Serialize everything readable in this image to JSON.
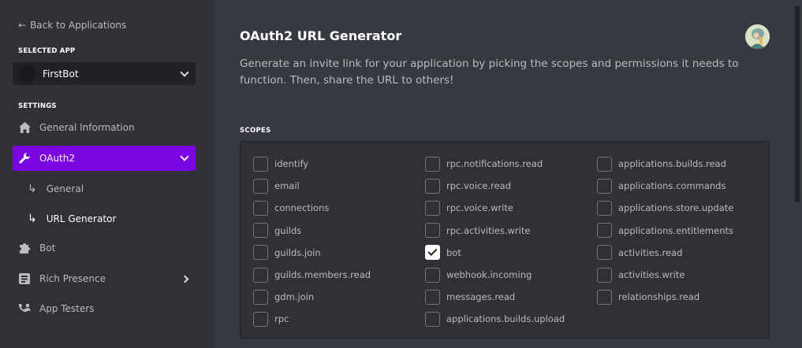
{
  "sidebar": {
    "back_label": "Back to Applications",
    "selected_app_label": "SELECTED APP",
    "app_name": "FirstBot",
    "settings_label": "SETTINGS",
    "items": [
      {
        "label": "General Information"
      },
      {
        "label": "OAuth2"
      },
      {
        "label": "General"
      },
      {
        "label": "URL Generator"
      },
      {
        "label": "Bot"
      },
      {
        "label": "Rich Presence"
      },
      {
        "label": "App Testers"
      }
    ]
  },
  "main": {
    "title": "OAuth2 URL Generator",
    "description": "Generate an invite link for your application by picking the scopes and permissions it needs to function. Then, share the URL to others!",
    "scopes_label": "SCOPES",
    "scopes": [
      [
        {
          "label": "identify",
          "checked": false
        },
        {
          "label": "email",
          "checked": false
        },
        {
          "label": "connections",
          "checked": false
        },
        {
          "label": "guilds",
          "checked": false
        },
        {
          "label": "guilds.join",
          "checked": false
        },
        {
          "label": "guilds.members.read",
          "checked": false
        },
        {
          "label": "gdm.join",
          "checked": false
        },
        {
          "label": "rpc",
          "checked": false
        }
      ],
      [
        {
          "label": "rpc.notifications.read",
          "checked": false
        },
        {
          "label": "rpc.voice.read",
          "checked": false
        },
        {
          "label": "rpc.voice.write",
          "checked": false
        },
        {
          "label": "rpc.activities.write",
          "checked": false
        },
        {
          "label": "bot",
          "checked": true
        },
        {
          "label": "webhook.incoming",
          "checked": false
        },
        {
          "label": "messages.read",
          "checked": false
        },
        {
          "label": "applications.builds.upload",
          "checked": false
        }
      ],
      [
        {
          "label": "applications.builds.read",
          "checked": false
        },
        {
          "label": "applications.commands",
          "checked": false
        },
        {
          "label": "applications.store.update",
          "checked": false
        },
        {
          "label": "applications.entitlements",
          "checked": false
        },
        {
          "label": "activities.read",
          "checked": false
        },
        {
          "label": "activities.write",
          "checked": false
        },
        {
          "label": "relationships.read",
          "checked": false
        }
      ]
    ]
  },
  "colors": {
    "accent": "#7b05e3",
    "sidebar_bg": "#2f3136",
    "main_bg": "#36393f"
  },
  "icons": {
    "back": "arrow-left-icon",
    "home": "home-icon",
    "oauth": "wrench-icon",
    "bot": "puzzle-icon",
    "rich_presence": "document-icon",
    "app_testers": "user-phone-icon"
  }
}
